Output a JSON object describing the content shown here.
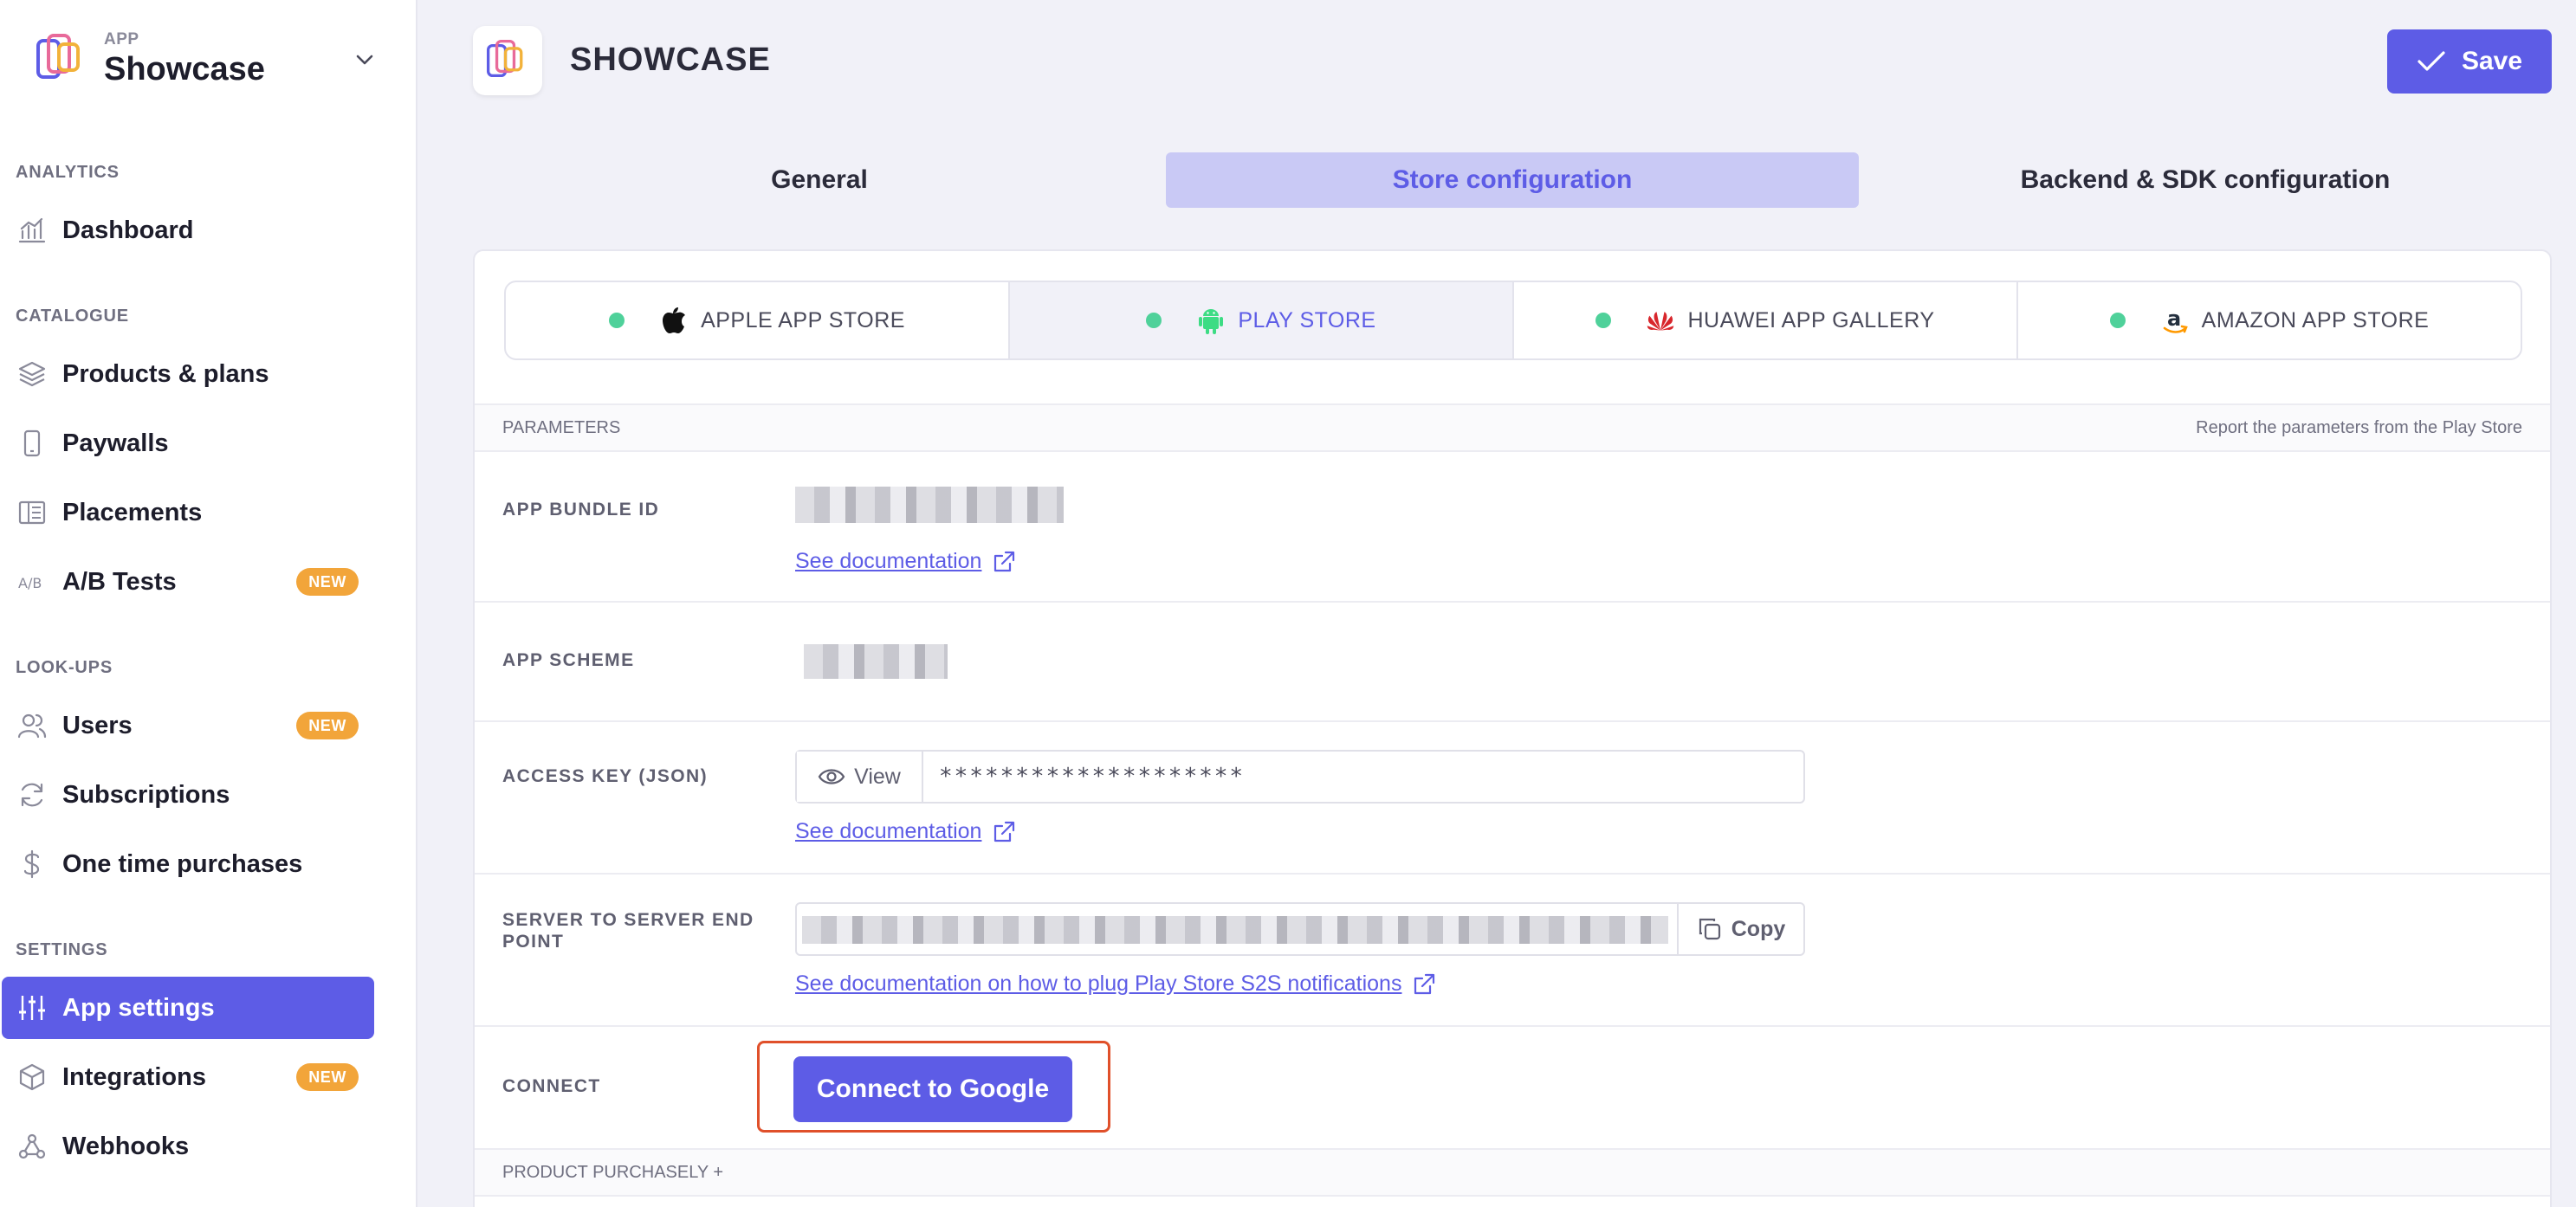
{
  "app": {
    "caption": "APP",
    "name": "Showcase"
  },
  "sidebar": {
    "sections": [
      {
        "title": "ANALYTICS",
        "items": [
          {
            "label": "Dashboard",
            "icon": "chart-icon"
          }
        ]
      },
      {
        "title": "CATALOGUE",
        "items": [
          {
            "label": "Products & plans",
            "icon": "layers-icon"
          },
          {
            "label": "Paywalls",
            "icon": "phone-icon"
          },
          {
            "label": "Placements",
            "icon": "layout-icon"
          },
          {
            "label": "A/B Tests",
            "icon": "ab-icon",
            "badge": "NEW"
          }
        ]
      },
      {
        "title": "LOOK-UPS",
        "items": [
          {
            "label": "Users",
            "icon": "users-icon",
            "badge": "NEW"
          },
          {
            "label": "Subscriptions",
            "icon": "refresh-icon"
          },
          {
            "label": "One time purchases",
            "icon": "dollar-icon"
          }
        ]
      },
      {
        "title": "SETTINGS",
        "items": [
          {
            "label": "App settings",
            "icon": "sliders-icon",
            "active": true
          },
          {
            "label": "Integrations",
            "icon": "cube-icon",
            "badge": "NEW"
          },
          {
            "label": "Webhooks",
            "icon": "webhook-icon"
          }
        ]
      }
    ]
  },
  "header": {
    "title": "SHOWCASE",
    "save_label": "Save"
  },
  "tabs": [
    {
      "label": "General",
      "active": false
    },
    {
      "label": "Store configuration",
      "active": true
    },
    {
      "label": "Backend & SDK configuration",
      "active": false
    }
  ],
  "store_tabs": [
    {
      "label": "APPLE APP STORE",
      "icon": "apple-icon",
      "active": false
    },
    {
      "label": "PLAY STORE",
      "icon": "android-icon",
      "active": true
    },
    {
      "label": "HUAWEI APP GALLERY",
      "icon": "huawei-icon",
      "active": false
    },
    {
      "label": "AMAZON APP STORE",
      "icon": "amazon-icon",
      "active": false
    }
  ],
  "parameters": {
    "title": "PARAMETERS",
    "hint": "Report the parameters from the Play Store"
  },
  "fields": {
    "bundle_id": {
      "label": "APP BUNDLE ID",
      "doc": "See documentation"
    },
    "scheme": {
      "label": "APP SCHEME"
    },
    "access_key": {
      "label": "ACCESS KEY (JSON)",
      "view_label": "View",
      "value": "********************",
      "doc": "See documentation"
    },
    "s2s": {
      "label": "SERVER TO SERVER END POINT",
      "copy_label": "Copy",
      "doc": "See documentation on how to plug Play Store S2S notifications"
    },
    "connect": {
      "label": "CONNECT",
      "button": "Connect to Google"
    }
  },
  "product_section": {
    "title": "PRODUCT PURCHASELY +"
  },
  "colors": {
    "accent": "#5d5ce6",
    "badge": "#f2a53a",
    "status_dot": "#4fd19a",
    "highlight": "#e0502a"
  }
}
